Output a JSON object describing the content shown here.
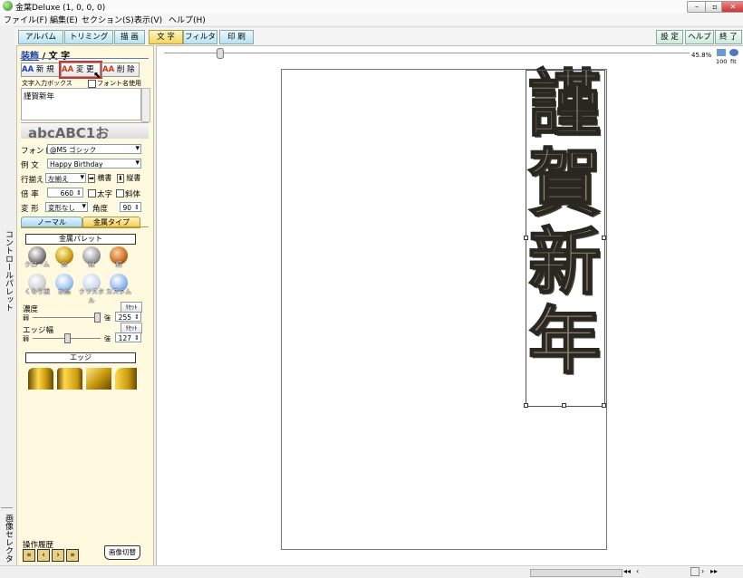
{
  "window": {
    "title": "金葉Deluxe (1, 0, 0, 0)"
  },
  "menu": [
    "ファイル(F)",
    "編集(E)",
    "セクション(S)",
    "表示(V)",
    "ヘルプ(H)"
  ],
  "tabs_left": [
    "アルバム",
    "トリミング",
    "描 画",
    "文 字",
    "フィルタ",
    "印 刷"
  ],
  "tabs_right": [
    "設 定",
    "ヘルプ",
    "終 了"
  ],
  "zoom": {
    "percent": "45.8%",
    "label_100": "100",
    "label_fit": "fit",
    "slider_fraction": 0.1
  },
  "left_strip": {
    "top": "コントロールパレット",
    "bottom": "画像セレクタ"
  },
  "palette": {
    "header_a": "装飾",
    "header_sep": "/",
    "header_b": "文 字",
    "btn_new": "新 規",
    "btn_change": "変 更",
    "btn_delete": "削 除",
    "input_label": "文字入力ボックス",
    "font_ok_label": "フォント名使用",
    "input_value": "謹賀新年",
    "preview_text": "abcABC1お",
    "font_label": "フォント",
    "font_value": "@MS ゴシック",
    "example_label": "例 文",
    "example_value": "Happy Birthday",
    "align_label": "行揃え",
    "align_value": "左揃え",
    "horizontal": "横書",
    "vertical": "縦書",
    "ratio_label": "倍 率",
    "ratio_value": "660",
    "bold_label": "太字",
    "italic_label": "斜体",
    "deform_label": "変 形",
    "deform_value": "変形なし",
    "angle_label": "角度",
    "angle_value": "90",
    "subtab_normal": "ノーマル",
    "subtab_metal": "金属タイプ",
    "metal_palette_title": "金属パレット",
    "metals": [
      "クローム",
      "金",
      "銀",
      "銅",
      "くもり銀",
      "水晶",
      "クリスタル",
      "カスタム"
    ],
    "density_label": "濃度",
    "reset": "ﾘｾｯﾄ",
    "weak": "弱",
    "strong": "強",
    "density_value": "255",
    "edge_width_label": "エッジ幅",
    "edge_width_value": "127",
    "edge_title": "エッジ",
    "history_label": "操作履歴",
    "image_switch": "画像切替"
  },
  "canvas": {
    "vertical_text": [
      "謹",
      "賀",
      "新",
      "年"
    ]
  },
  "colors": {
    "accent_tab": "#f4d45a",
    "canvas_text": "#8a8175"
  }
}
